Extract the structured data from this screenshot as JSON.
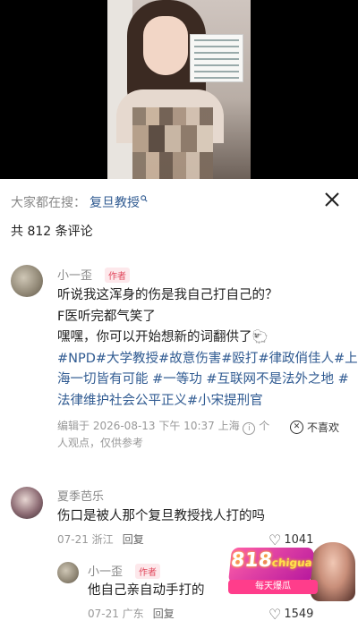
{
  "search": {
    "prefix": "大家都在搜：",
    "keyword": "复旦教授",
    "icon": "search-icon",
    "close_icon": "close-icon"
  },
  "comments_count_text": "共 812 条评论",
  "comments": [
    {
      "username": "小一歪",
      "author_tag": "作者",
      "line1": "听说我这浑身的伤是我自己打自己的？",
      "line2": "F医听完都气笑了",
      "line3": "嘿嘿，你可以开始想新的词翻供了🐑",
      "hashtags_line1": "#NPD#大学教授#故意伤害#殴打#律政俏佳人#上",
      "hashtags_line2": "海一切皆有可能 #一等功 #互联网不是法外之地 #",
      "hashtags_line3": "法律维护社会公平正义#小宋提刑官",
      "meta_line1": "编辑于  2026-08-13 下午 10:37 上海",
      "meta_line1_suffix": "个",
      "meta_line2": "人观点，仅供参考",
      "dislike_label": "不喜欢"
    },
    {
      "username": "夏季芭乐",
      "text": "伤口是被人那个复旦教授找人打的吗",
      "date": "07-21 浙江",
      "reply_label": "回复",
      "likes": "1041"
    },
    {
      "username": "小一歪",
      "author_tag": "作者",
      "text": "他自己亲自动手打的",
      "date": "07-21 广东",
      "reply_label": "回复",
      "likes": "1549"
    }
  ],
  "watermark": {
    "brand": "818",
    "brand_sub": "chigua",
    "slogan": "每天爆瓜"
  }
}
